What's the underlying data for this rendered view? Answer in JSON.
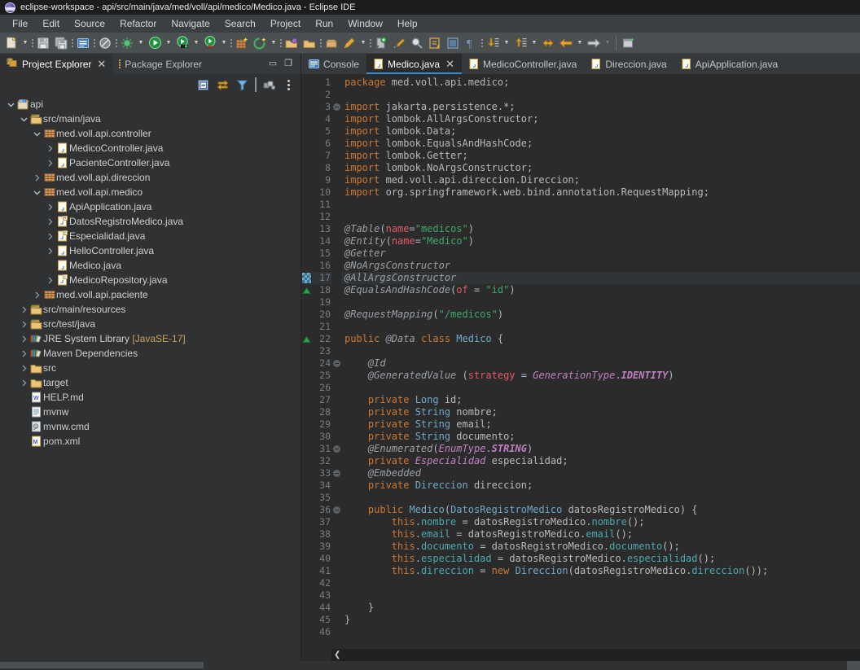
{
  "window": {
    "title": "eclipse-workspace - api/src/main/java/med/voll/api/medico/Medico.java - Eclipse IDE",
    "logo_icon": "eclipse-logo-icon"
  },
  "menubar": {
    "items": [
      "File",
      "Edit",
      "Source",
      "Refactor",
      "Navigate",
      "Search",
      "Project",
      "Run",
      "Window",
      "Help"
    ]
  },
  "toolbar": {
    "buttons": [
      "new-wizard-icon",
      "save-icon",
      "save-all-icon",
      "console-icon",
      "skip-breakpoints-icon",
      "debug-icon",
      "run-icon",
      "coverage-icon",
      "run-last-tool-icon",
      "new-package-icon",
      "new-project-icon",
      "open-type-icon",
      "open-task-icon",
      "open-perspective-icon",
      "pencil-icon",
      "toggle-mark-occurrences-icon",
      "build-icon",
      "search-icon",
      "next-annotation-icon",
      "previous-annotation-icon",
      "last-edit-location-icon",
      "back-icon",
      "forward-icon",
      "pin-editor-icon"
    ]
  },
  "left_panel": {
    "tabs": [
      {
        "label": "Project Explorer",
        "icon": "project-explorer-icon",
        "active": true,
        "closable": true
      },
      {
        "label": "Package Explorer",
        "icon": "package-explorer-icon",
        "active": false,
        "closable": false
      }
    ],
    "window_buttons": [
      "minimize-icon",
      "maximize-icon"
    ],
    "toolbar_buttons": [
      "collapse-all-icon",
      "link-with-editor-icon",
      "view-filter-icon",
      "view-menu-focus-icon",
      "view-menu-icon"
    ]
  },
  "tree": [
    {
      "label": "api",
      "depth": 0,
      "twisty": "open",
      "icon": "java-project-icon"
    },
    {
      "label": "src/main/java",
      "depth": 1,
      "twisty": "open",
      "icon": "source-folder-icon"
    },
    {
      "label": "med.voll.api.controller",
      "depth": 2,
      "twisty": "open",
      "icon": "package-icon"
    },
    {
      "label": "MedicoController.java",
      "depth": 3,
      "twisty": "closed",
      "icon": "java-file-icon"
    },
    {
      "label": "PacienteController.java",
      "depth": 3,
      "twisty": "closed",
      "icon": "java-file-icon"
    },
    {
      "label": "med.voll.api.direccion",
      "depth": 2,
      "twisty": "closed",
      "icon": "package-icon"
    },
    {
      "label": "med.voll.api.medico",
      "depth": 2,
      "twisty": "open",
      "icon": "package-icon"
    },
    {
      "label": "ApiApplication.java",
      "depth": 3,
      "twisty": "closed",
      "icon": "java-file-icon"
    },
    {
      "label": "DatosRegistroMedico.java",
      "depth": 3,
      "twisty": "closed",
      "icon": "java-record-icon"
    },
    {
      "label": "Especialidad.java",
      "depth": 3,
      "twisty": "closed",
      "icon": "java-enum-icon"
    },
    {
      "label": "HelloController.java",
      "depth": 3,
      "twisty": "closed",
      "icon": "java-file-icon"
    },
    {
      "label": "Medico.java",
      "depth": 3,
      "twisty": "none",
      "icon": "java-file-icon"
    },
    {
      "label": "MedicoRepository.java",
      "depth": 3,
      "twisty": "closed",
      "icon": "java-interface-icon"
    },
    {
      "label": "med.voll.api.paciente",
      "depth": 2,
      "twisty": "closed",
      "icon": "package-icon"
    },
    {
      "label": "src/main/resources",
      "depth": 1,
      "twisty": "closed",
      "icon": "source-folder-icon"
    },
    {
      "label": "src/test/java",
      "depth": 1,
      "twisty": "closed",
      "icon": "source-folder-icon"
    },
    {
      "label": "JRE System Library [JavaSE-17]",
      "depth": 1,
      "twisty": "closed",
      "icon": "library-icon"
    },
    {
      "label": "Maven Dependencies",
      "depth": 1,
      "twisty": "closed",
      "icon": "library-icon"
    },
    {
      "label": "src",
      "depth": 1,
      "twisty": "closed",
      "icon": "folder-icon"
    },
    {
      "label": "target",
      "depth": 1,
      "twisty": "closed",
      "icon": "folder-icon"
    },
    {
      "label": "HELP.md",
      "depth": 1,
      "twisty": "none",
      "icon": "markdown-file-icon"
    },
    {
      "label": "mvnw",
      "depth": 1,
      "twisty": "none",
      "icon": "text-file-icon"
    },
    {
      "label": "mvnw.cmd",
      "depth": 1,
      "twisty": "none",
      "icon": "cmd-file-icon"
    },
    {
      "label": "pom.xml",
      "depth": 1,
      "twisty": "none",
      "icon": "maven-file-icon"
    }
  ],
  "editor_tabs": [
    {
      "label": "Console",
      "icon": "console-icon",
      "active": false,
      "closable": false
    },
    {
      "label": "Medico.java",
      "icon": "java-file-icon",
      "active": true,
      "closable": true
    },
    {
      "label": "MedicoController.java",
      "icon": "java-file-icon",
      "active": false,
      "closable": false
    },
    {
      "label": "Direccion.java",
      "icon": "java-file-icon",
      "active": false,
      "closable": false
    },
    {
      "label": "ApiApplication.java",
      "icon": "java-file-icon",
      "active": false,
      "closable": false
    }
  ],
  "editor": {
    "first_line": 1,
    "last_line": 46,
    "highlighted_line": 17,
    "scroll_left_icon": "scroll-left-chevron-icon",
    "markers": [
      {
        "line": 17,
        "type": "changed-line-marker"
      },
      {
        "line": 18,
        "type": "warning-marker"
      },
      {
        "line": 22,
        "type": "warning-marker"
      }
    ],
    "fold_markers": [
      3,
      24,
      31,
      33,
      36
    ],
    "lines": [
      {
        "n": 1,
        "tokens": [
          {
            "t": "package ",
            "c": "k"
          },
          {
            "t": "med.voll.api.medico;",
            "c": "pln"
          }
        ]
      },
      {
        "n": 2,
        "tokens": []
      },
      {
        "n": 3,
        "tokens": [
          {
            "t": "import ",
            "c": "k"
          },
          {
            "t": "jakarta.persistence.*;",
            "c": "pln"
          }
        ]
      },
      {
        "n": 4,
        "tokens": [
          {
            "t": "import ",
            "c": "k"
          },
          {
            "t": "lombok.AllArgsConstructor;",
            "c": "pln"
          }
        ]
      },
      {
        "n": 5,
        "tokens": [
          {
            "t": "import ",
            "c": "k"
          },
          {
            "t": "lombok.Data;",
            "c": "pln"
          }
        ]
      },
      {
        "n": 6,
        "tokens": [
          {
            "t": "import ",
            "c": "k"
          },
          {
            "t": "lombok.EqualsAndHashCode;",
            "c": "pln"
          }
        ]
      },
      {
        "n": 7,
        "tokens": [
          {
            "t": "import ",
            "c": "k"
          },
          {
            "t": "lombok.Getter;",
            "c": "pln"
          }
        ]
      },
      {
        "n": 8,
        "tokens": [
          {
            "t": "import ",
            "c": "k"
          },
          {
            "t": "lombok.NoArgsConstructor;",
            "c": "pln"
          }
        ]
      },
      {
        "n": 9,
        "tokens": [
          {
            "t": "import ",
            "c": "k"
          },
          {
            "t": "med.voll.api.direccion.Direccion;",
            "c": "pln"
          }
        ]
      },
      {
        "n": 10,
        "tokens": [
          {
            "t": "import ",
            "c": "k"
          },
          {
            "t": "org.springframework.web.bind.annotation.RequestMapping;",
            "c": "pln"
          }
        ]
      },
      {
        "n": 11,
        "tokens": []
      },
      {
        "n": 12,
        "tokens": []
      },
      {
        "n": 13,
        "tokens": [
          {
            "t": "@Table",
            "c": "ann"
          },
          {
            "t": "(",
            "c": "op"
          },
          {
            "t": "name",
            "c": "attr"
          },
          {
            "t": "=",
            "c": "op"
          },
          {
            "t": "\"medicos\"",
            "c": "str"
          },
          {
            "t": ")",
            "c": "op"
          }
        ]
      },
      {
        "n": 14,
        "tokens": [
          {
            "t": "@Entity",
            "c": "ann"
          },
          {
            "t": "(",
            "c": "op"
          },
          {
            "t": "name",
            "c": "attr"
          },
          {
            "t": "=",
            "c": "op"
          },
          {
            "t": "\"Medico\"",
            "c": "str"
          },
          {
            "t": ")",
            "c": "op"
          }
        ]
      },
      {
        "n": 15,
        "tokens": [
          {
            "t": "@Getter",
            "c": "ann"
          }
        ]
      },
      {
        "n": 16,
        "tokens": [
          {
            "t": "@NoArgsConstructor",
            "c": "ann"
          }
        ]
      },
      {
        "n": 17,
        "tokens": [
          {
            "t": "@AllArgsConstructor",
            "c": "ann"
          }
        ]
      },
      {
        "n": 18,
        "tokens": [
          {
            "t": "@EqualsAndHashCode",
            "c": "ann"
          },
          {
            "t": "(",
            "c": "op"
          },
          {
            "t": "of",
            "c": "attr"
          },
          {
            "t": " = ",
            "c": "op"
          },
          {
            "t": "\"id\"",
            "c": "str"
          },
          {
            "t": ")",
            "c": "op"
          }
        ]
      },
      {
        "n": 19,
        "tokens": []
      },
      {
        "n": 20,
        "tokens": [
          {
            "t": "@RequestMapping",
            "c": "ann"
          },
          {
            "t": "(",
            "c": "op"
          },
          {
            "t": "\"/medicos\"",
            "c": "str"
          },
          {
            "t": ")",
            "c": "op"
          }
        ]
      },
      {
        "n": 21,
        "tokens": []
      },
      {
        "n": 22,
        "tokens": [
          {
            "t": "public ",
            "c": "k"
          },
          {
            "t": "@Data",
            "c": "ann"
          },
          {
            "t": " ",
            "c": "op"
          },
          {
            "t": "class ",
            "c": "k"
          },
          {
            "t": "Medico",
            "c": "typ"
          },
          {
            "t": " {",
            "c": "op"
          }
        ]
      },
      {
        "n": 23,
        "tokens": []
      },
      {
        "n": 24,
        "tokens": [
          {
            "t": "    ",
            "c": "op"
          },
          {
            "t": "@Id",
            "c": "ann"
          }
        ]
      },
      {
        "n": 25,
        "tokens": [
          {
            "t": "    ",
            "c": "op"
          },
          {
            "t": "@GeneratedValue",
            "c": "ann"
          },
          {
            "t": " (",
            "c": "op"
          },
          {
            "t": "strategy",
            "c": "attr"
          },
          {
            "t": " = ",
            "c": "op"
          },
          {
            "t": "GenerationType",
            "c": "typi"
          },
          {
            "t": ".",
            "c": "op"
          },
          {
            "t": "IDENTITY",
            "c": "typb"
          },
          {
            "t": ")",
            "c": "op"
          }
        ]
      },
      {
        "n": 26,
        "tokens": []
      },
      {
        "n": 27,
        "tokens": [
          {
            "t": "    ",
            "c": "op"
          },
          {
            "t": "private ",
            "c": "k"
          },
          {
            "t": "Long",
            "c": "typ"
          },
          {
            "t": " id;",
            "c": "pln"
          }
        ]
      },
      {
        "n": 28,
        "tokens": [
          {
            "t": "    ",
            "c": "op"
          },
          {
            "t": "private ",
            "c": "k"
          },
          {
            "t": "String",
            "c": "typ"
          },
          {
            "t": " nombre;",
            "c": "pln"
          }
        ]
      },
      {
        "n": 29,
        "tokens": [
          {
            "t": "    ",
            "c": "op"
          },
          {
            "t": "private ",
            "c": "k"
          },
          {
            "t": "String",
            "c": "typ"
          },
          {
            "t": " email;",
            "c": "pln"
          }
        ]
      },
      {
        "n": 30,
        "tokens": [
          {
            "t": "    ",
            "c": "op"
          },
          {
            "t": "private ",
            "c": "k"
          },
          {
            "t": "String",
            "c": "typ"
          },
          {
            "t": " documento;",
            "c": "pln"
          }
        ]
      },
      {
        "n": 31,
        "tokens": [
          {
            "t": "    ",
            "c": "op"
          },
          {
            "t": "@Enumerated",
            "c": "ann"
          },
          {
            "t": "(",
            "c": "op"
          },
          {
            "t": "EnumType",
            "c": "typi"
          },
          {
            "t": ".",
            "c": "op"
          },
          {
            "t": "STRING",
            "c": "typb"
          },
          {
            "t": ")",
            "c": "op"
          }
        ]
      },
      {
        "n": 32,
        "tokens": [
          {
            "t": "    ",
            "c": "op"
          },
          {
            "t": "private ",
            "c": "k"
          },
          {
            "t": "Especialidad",
            "c": "typi"
          },
          {
            "t": " especialidad;",
            "c": "pln"
          }
        ]
      },
      {
        "n": 33,
        "tokens": [
          {
            "t": "    ",
            "c": "op"
          },
          {
            "t": "@Embedded",
            "c": "ann"
          }
        ]
      },
      {
        "n": 34,
        "tokens": [
          {
            "t": "    ",
            "c": "op"
          },
          {
            "t": "private ",
            "c": "k"
          },
          {
            "t": "Direccion",
            "c": "typ"
          },
          {
            "t": " direccion;",
            "c": "pln"
          }
        ]
      },
      {
        "n": 35,
        "tokens": []
      },
      {
        "n": 36,
        "tokens": [
          {
            "t": "    ",
            "c": "op"
          },
          {
            "t": "public ",
            "c": "k"
          },
          {
            "t": "Medico",
            "c": "typ"
          },
          {
            "t": "(",
            "c": "op"
          },
          {
            "t": "DatosRegistroMedico",
            "c": "typ"
          },
          {
            "t": " datosRegistroMedico) {",
            "c": "pln"
          }
        ]
      },
      {
        "n": 37,
        "tokens": [
          {
            "t": "        ",
            "c": "op"
          },
          {
            "t": "this",
            "c": "k"
          },
          {
            "t": ".",
            "c": "op"
          },
          {
            "t": "nombre",
            "c": "fld"
          },
          {
            "t": " = datosRegistroMedico.",
            "c": "pln"
          },
          {
            "t": "nombre",
            "c": "fld"
          },
          {
            "t": "();",
            "c": "pln"
          }
        ]
      },
      {
        "n": 38,
        "tokens": [
          {
            "t": "        ",
            "c": "op"
          },
          {
            "t": "this",
            "c": "k"
          },
          {
            "t": ".",
            "c": "op"
          },
          {
            "t": "email",
            "c": "fld"
          },
          {
            "t": " = datosRegistroMedico.",
            "c": "pln"
          },
          {
            "t": "email",
            "c": "fld"
          },
          {
            "t": "();",
            "c": "pln"
          }
        ]
      },
      {
        "n": 39,
        "tokens": [
          {
            "t": "        ",
            "c": "op"
          },
          {
            "t": "this",
            "c": "k"
          },
          {
            "t": ".",
            "c": "op"
          },
          {
            "t": "documento",
            "c": "fld"
          },
          {
            "t": " = datosRegistroMedico.",
            "c": "pln"
          },
          {
            "t": "documento",
            "c": "fld"
          },
          {
            "t": "();",
            "c": "pln"
          }
        ]
      },
      {
        "n": 40,
        "tokens": [
          {
            "t": "        ",
            "c": "op"
          },
          {
            "t": "this",
            "c": "k"
          },
          {
            "t": ".",
            "c": "op"
          },
          {
            "t": "especialidad",
            "c": "fld"
          },
          {
            "t": " = datosRegistroMedico.",
            "c": "pln"
          },
          {
            "t": "especialidad",
            "c": "fld"
          },
          {
            "t": "();",
            "c": "pln"
          }
        ]
      },
      {
        "n": 41,
        "tokens": [
          {
            "t": "        ",
            "c": "op"
          },
          {
            "t": "this",
            "c": "k"
          },
          {
            "t": ".",
            "c": "op"
          },
          {
            "t": "direccion",
            "c": "fld"
          },
          {
            "t": " = ",
            "c": "pln"
          },
          {
            "t": "new ",
            "c": "k"
          },
          {
            "t": "Direccion",
            "c": "typ"
          },
          {
            "t": "(datosRegistroMedico.",
            "c": "pln"
          },
          {
            "t": "direccion",
            "c": "fld"
          },
          {
            "t": "());",
            "c": "pln"
          }
        ]
      },
      {
        "n": 42,
        "tokens": []
      },
      {
        "n": 43,
        "tokens": []
      },
      {
        "n": 44,
        "tokens": [
          {
            "t": "    }",
            "c": "op"
          }
        ]
      },
      {
        "n": 45,
        "tokens": [
          {
            "t": "}",
            "c": "op"
          }
        ]
      },
      {
        "n": 46,
        "tokens": []
      }
    ]
  },
  "colors": {
    "titlebar_bg": "#1c1c1c",
    "menubar_bg": "#3b3f41",
    "toolbar_bg": "#4a4f51",
    "panel_bg": "#2f3133",
    "editor_bg": "#2b2b2b",
    "tab_strip_bg": "#36393b",
    "active_tab_accent": "#2f8fd9",
    "keyword": "#cc7832",
    "string": "#3fa86b",
    "annotation": "#9aa0a6",
    "attribute": "#e15b64",
    "type": "#6fa8c9",
    "field": "#4aa9b0",
    "line_number": "#757d85",
    "highlight_line": "#313437"
  }
}
